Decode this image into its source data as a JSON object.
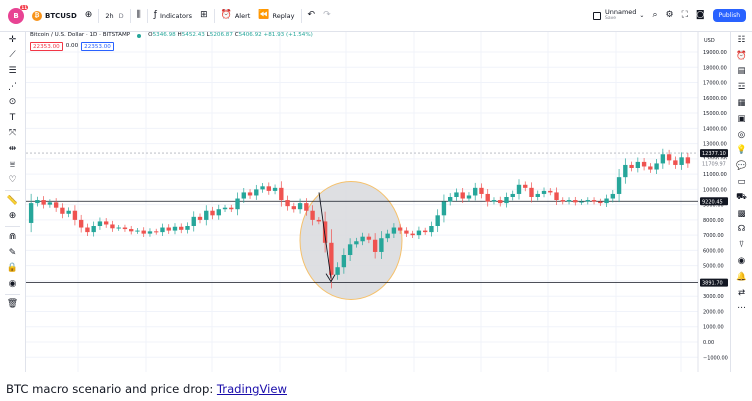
{
  "toolbar": {
    "avatar_letter": "B",
    "avatar_badge": "11",
    "symbol_badge": "₿",
    "symbol": "BTCUSD",
    "add_symbol_icon": "plus-circle-icon",
    "interval": "2h",
    "interval_sub": "D",
    "indicators_label": "Indicators",
    "alert_label": "Alert",
    "replay_label": "Replay",
    "layout_name": "Unnamed",
    "layout_sub": "Save",
    "publish_label": "Publish"
  },
  "legend": {
    "title": "Bitcoin / U.S. Dollar · 1D · BITSTAMP",
    "open_label": "O",
    "open": "5346.98",
    "high_label": "H",
    "high": "5452.43",
    "low_label": "L",
    "low": "5206.87",
    "close_label": "C",
    "close": "5406.92",
    "change": "+81.93 (+1.54%)",
    "sell_price": "22353.00",
    "spread": "0.00",
    "buy_price": "22353.00"
  },
  "price_axis": {
    "currency": "USD",
    "ticks": [
      "19000.00",
      "18000.00",
      "17000.00",
      "16000.00",
      "15000.00",
      "14000.00",
      "13000.00",
      "12000.00",
      "11000.00",
      "10000.00",
      "9000.00",
      "8000.00",
      "7000.00",
      "6000.00",
      "5000.00",
      "4000.00",
      "3000.00",
      "2000.00",
      "1000.00",
      "0.00",
      "−1000.00"
    ],
    "current_price_tag": "12377.10",
    "current_price_sub": "11709.97",
    "upper_line_tag": "9220.45",
    "lower_line_tag": "3891.70"
  },
  "chart_data": {
    "type": "candlestick",
    "symbol": "BTCUSD",
    "yrange": [
      -1000,
      19000
    ],
    "horizontal_lines": [
      9220.45,
      3891.7
    ],
    "current_price_line": 12377.1,
    "annotation": {
      "shape": "ellipse",
      "note": "arrow pointing down to the price drop low"
    },
    "series": [
      {
        "o": 7800,
        "c": 9100
      },
      {
        "o": 9100,
        "c": 9300
      },
      {
        "o": 9300,
        "c": 9000
      },
      {
        "o": 9000,
        "c": 9150
      },
      {
        "o": 9150,
        "c": 8800
      },
      {
        "o": 8800,
        "c": 8400
      },
      {
        "o": 8400,
        "c": 8600
      },
      {
        "o": 8600,
        "c": 8000
      },
      {
        "o": 8000,
        "c": 7500
      },
      {
        "o": 7500,
        "c": 7200
      },
      {
        "o": 7200,
        "c": 7600
      },
      {
        "o": 7600,
        "c": 7900
      },
      {
        "o": 7900,
        "c": 7700
      },
      {
        "o": 7700,
        "c": 7450
      },
      {
        "o": 7450,
        "c": 7500
      },
      {
        "o": 7500,
        "c": 7400
      },
      {
        "o": 7400,
        "c": 7250
      },
      {
        "o": 7250,
        "c": 7300
      },
      {
        "o": 7300,
        "c": 7100
      },
      {
        "o": 7100,
        "c": 7250
      },
      {
        "o": 7250,
        "c": 7200
      },
      {
        "o": 7200,
        "c": 7500
      },
      {
        "o": 7500,
        "c": 7300
      },
      {
        "o": 7300,
        "c": 7550
      },
      {
        "o": 7550,
        "c": 7350
      },
      {
        "o": 7350,
        "c": 7600
      },
      {
        "o": 7600,
        "c": 8200
      },
      {
        "o": 8200,
        "c": 8000
      },
      {
        "o": 8000,
        "c": 8600
      },
      {
        "o": 8600,
        "c": 8300
      },
      {
        "o": 8300,
        "c": 8700
      },
      {
        "o": 8700,
        "c": 8800
      },
      {
        "o": 8800,
        "c": 8700
      },
      {
        "o": 8700,
        "c": 9400
      },
      {
        "o": 9400,
        "c": 9800
      },
      {
        "o": 9800,
        "c": 9600
      },
      {
        "o": 9600,
        "c": 10000
      },
      {
        "o": 10000,
        "c": 10200
      },
      {
        "o": 10200,
        "c": 9900
      },
      {
        "o": 9900,
        "c": 10100
      },
      {
        "o": 10100,
        "c": 9300
      },
      {
        "o": 9300,
        "c": 8900
      },
      {
        "o": 8900,
        "c": 8700
      },
      {
        "o": 8700,
        "c": 9100
      },
      {
        "o": 9100,
        "c": 8600
      },
      {
        "o": 8600,
        "c": 8000
      },
      {
        "o": 8000,
        "c": 7900
      },
      {
        "o": 7900,
        "c": 6500
      },
      {
        "o": 6500,
        "c": 4400
      },
      {
        "o": 4400,
        "c": 4900
      },
      {
        "o": 4900,
        "c": 5700
      },
      {
        "o": 5700,
        "c": 6400
      },
      {
        "o": 6400,
        "c": 6600
      },
      {
        "o": 6600,
        "c": 6900
      },
      {
        "o": 6900,
        "c": 6700
      },
      {
        "o": 6700,
        "c": 5900
      },
      {
        "o": 5900,
        "c": 6800
      },
      {
        "o": 6800,
        "c": 7100
      },
      {
        "o": 7100,
        "c": 7500
      },
      {
        "o": 7500,
        "c": 7300
      },
      {
        "o": 7300,
        "c": 7100
      },
      {
        "o": 7100,
        "c": 7000
      },
      {
        "o": 7000,
        "c": 7300
      },
      {
        "o": 7300,
        "c": 7200
      },
      {
        "o": 7200,
        "c": 7600
      },
      {
        "o": 7600,
        "c": 8300
      },
      {
        "o": 8300,
        "c": 9200
      },
      {
        "o": 9200,
        "c": 9500
      },
      {
        "o": 9500,
        "c": 9800
      },
      {
        "o": 9800,
        "c": 9400
      },
      {
        "o": 9400,
        "c": 9600
      },
      {
        "o": 9600,
        "c": 10100
      },
      {
        "o": 10100,
        "c": 9700
      },
      {
        "o": 9700,
        "c": 9200
      },
      {
        "o": 9200,
        "c": 9300
      },
      {
        "o": 9300,
        "c": 9100
      },
      {
        "o": 9100,
        "c": 9500
      },
      {
        "o": 9500,
        "c": 9700
      },
      {
        "o": 9700,
        "c": 10300
      },
      {
        "o": 10300,
        "c": 10100
      },
      {
        "o": 10100,
        "c": 9500
      },
      {
        "o": 9500,
        "c": 9700
      },
      {
        "o": 9700,
        "c": 9900
      },
      {
        "o": 9900,
        "c": 9800
      },
      {
        "o": 9800,
        "c": 9300
      },
      {
        "o": 9300,
        "c": 9200
      },
      {
        "o": 9200,
        "c": 9300
      },
      {
        "o": 9300,
        "c": 9150
      },
      {
        "o": 9150,
        "c": 9200
      },
      {
        "o": 9200,
        "c": 9300
      },
      {
        "o": 9300,
        "c": 9200
      },
      {
        "o": 9200,
        "c": 9100
      },
      {
        "o": 9100,
        "c": 9400
      },
      {
        "o": 9400,
        "c": 9700
      },
      {
        "o": 9700,
        "c": 10800
      },
      {
        "o": 10800,
        "c": 11600
      },
      {
        "o": 11600,
        "c": 11400
      },
      {
        "o": 11400,
        "c": 11800
      },
      {
        "o": 11800,
        "c": 11500
      },
      {
        "o": 11500,
        "c": 11300
      },
      {
        "o": 11300,
        "c": 11700
      },
      {
        "o": 11700,
        "c": 12300
      },
      {
        "o": 12300,
        "c": 11900
      },
      {
        "o": 11900,
        "c": 11600
      },
      {
        "o": 11600,
        "c": 12100
      },
      {
        "o": 12100,
        "c": 11700
      }
    ]
  },
  "caption": {
    "text": "BTC macro scenario and price drop: ",
    "link": "TradingView"
  }
}
